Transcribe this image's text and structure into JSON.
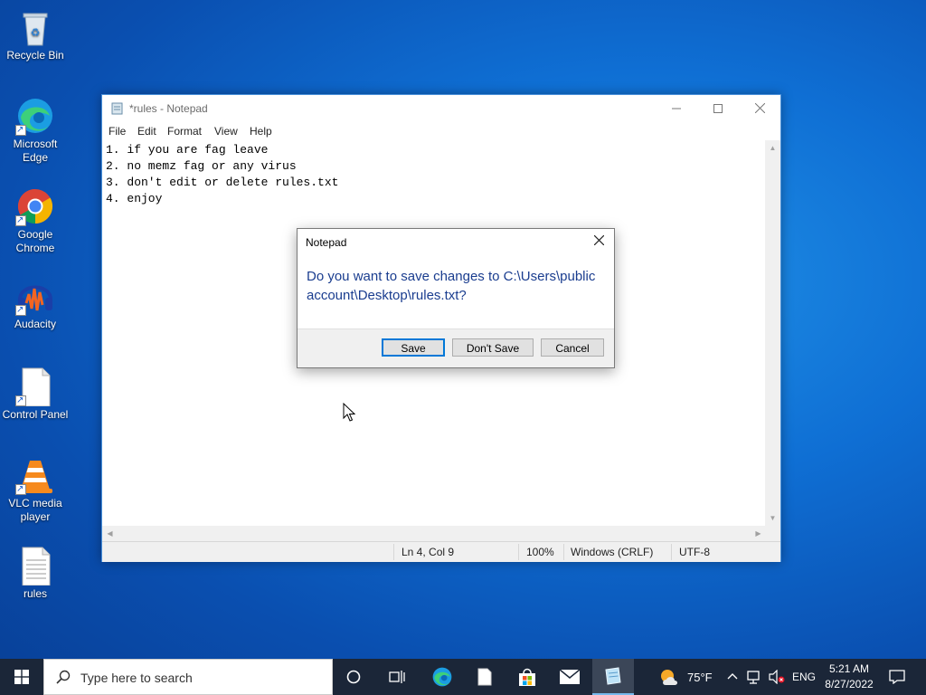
{
  "desktop": {
    "icons": [
      {
        "label": "Recycle Bin"
      },
      {
        "label": "Microsoft Edge"
      },
      {
        "label": "Google Chrome"
      },
      {
        "label": "Audacity"
      },
      {
        "label": "Control Panel"
      },
      {
        "label": "VLC media player"
      },
      {
        "label": "rules"
      }
    ]
  },
  "notepad": {
    "title": "*rules - Notepad",
    "menu": [
      "File",
      "Edit",
      "Format",
      "View",
      "Help"
    ],
    "lines": [
      "1. if you are fag leave",
      "2. no memz fag or any virus",
      "3. don't edit or delete rules.txt",
      "4. enjoy"
    ],
    "status": {
      "position": "Ln 4, Col 9",
      "zoom": "100%",
      "line_endings": "Windows (CRLF)",
      "encoding": "UTF-8"
    }
  },
  "dialog": {
    "title": "Notepad",
    "message": "Do you want to save changes to C:\\Users\\public account\\Desktop\\rules.txt?",
    "save_label": "Save",
    "dont_save_label": "Don't Save",
    "cancel_label": "Cancel"
  },
  "taskbar": {
    "search_placeholder": "Type here to search",
    "weather": "75°F",
    "language": "ENG",
    "time": "5:21 AM",
    "date": "8/27/2022"
  },
  "colors": {
    "accent": "#0078d7",
    "dialog_text": "#1a3d8f",
    "taskbar": "#1b2638"
  }
}
